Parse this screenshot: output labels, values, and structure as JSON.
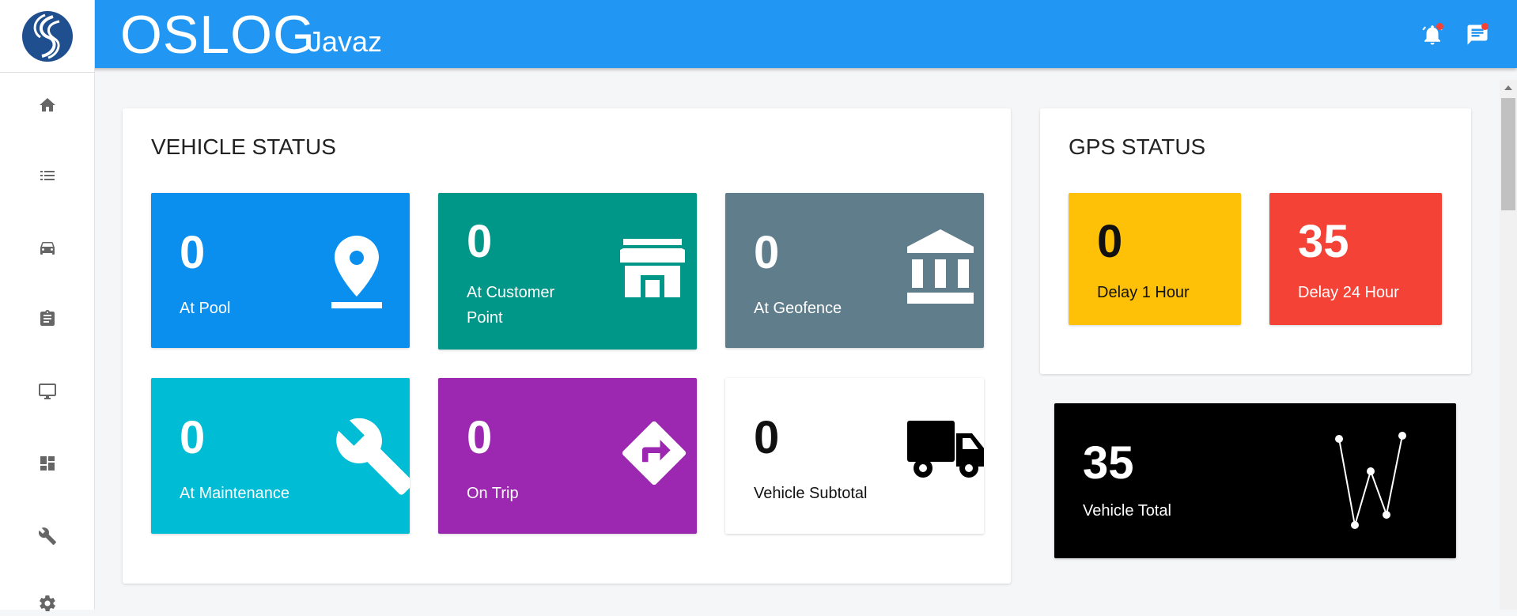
{
  "header": {
    "brand": "OSLOG",
    "sub_brand": "Javaz"
  },
  "sidebar": {
    "items": [
      {
        "icon": "home-icon"
      },
      {
        "icon": "list-icon"
      },
      {
        "icon": "car-icon"
      },
      {
        "icon": "clipboard-icon"
      },
      {
        "icon": "monitor-icon"
      },
      {
        "icon": "dashboard-icon"
      },
      {
        "icon": "wrench-icon"
      },
      {
        "icon": "gear-icon"
      }
    ]
  },
  "vehicle_status": {
    "title": "VEHICLE STATUS",
    "tiles": [
      {
        "value": "0",
        "label": "At Pool",
        "color": "#0a8fef",
        "icon": "location-pin-icon"
      },
      {
        "value": "0",
        "label": "At Customer Point",
        "color": "#009688",
        "icon": "store-icon"
      },
      {
        "value": "0",
        "label": "At Geofence",
        "color": "#607d8b",
        "icon": "bank-icon"
      },
      {
        "value": "0",
        "label": "At Maintenance",
        "color": "#00bcd4",
        "icon": "wrench-icon"
      },
      {
        "value": "0",
        "label": "On Trip",
        "color": "#9c27b0",
        "icon": "directions-icon"
      },
      {
        "value": "0",
        "label": "Vehicle Subtotal",
        "color": "#ffffff",
        "icon": "truck-icon"
      }
    ]
  },
  "gps_status": {
    "title": "GPS STATUS",
    "tiles": [
      {
        "value": "0",
        "label": "Delay 1 Hour",
        "color": "#ffc107"
      },
      {
        "value": "35",
        "label": "Delay 24 Hour",
        "color": "#f44336"
      }
    ]
  },
  "vehicle_total": {
    "value": "35",
    "label": "Vehicle Total",
    "color": "#000000",
    "icon": "sparkline-icon"
  }
}
